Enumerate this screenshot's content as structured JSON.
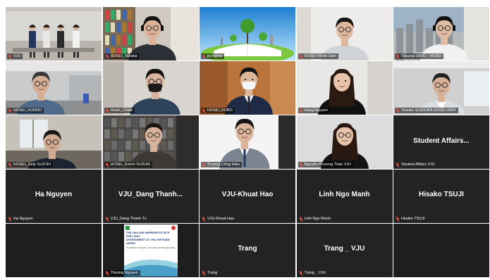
{
  "meeting": {
    "participants": [
      {
        "id": "p1",
        "label": "VJU",
        "scene": "room-group"
      },
      {
        "id": "p2",
        "label": "HOSEI_Tanaka",
        "scene": "man-headset-shelf",
        "active": true
      },
      {
        "id": "p3",
        "label": "pv.Nghia",
        "scene": "landscape-book"
      },
      {
        "id": "p4",
        "label": "HOSEI Hiroki Sato",
        "scene": "man-white-wall"
      },
      {
        "id": "p5",
        "label": "Takuma SATO - HOSEI",
        "scene": "man-window-city"
      },
      {
        "id": "p6",
        "label": "HOSEI_KONDO",
        "scene": "man-office"
      },
      {
        "id": "p7",
        "label": "Hosei_Chida",
        "scene": "man-mask-glasses"
      },
      {
        "id": "p8",
        "label": "HOSEI_KUBO",
        "scene": "man-mask-suit"
      },
      {
        "id": "p9",
        "label": "Hang Nguyen",
        "scene": "woman-long-hair"
      },
      {
        "id": "p10",
        "label": "Yosuke SUGIURA HOSEI UNIV.",
        "scene": "man-glasses-office"
      },
      {
        "id": "p11",
        "label": "HOSEI_Junji SUZUKI",
        "scene": "man-room-window"
      },
      {
        "id": "p12",
        "label": "HOSEI_Koichi SUZUKI",
        "scene": "man-bookshelf"
      },
      {
        "id": "p13",
        "label": "Trương Công Hiếu",
        "scene": "man-suit-white"
      },
      {
        "id": "p14",
        "label": "Nguyễn Phương Thảo VJU",
        "scene": "woman-grey-wall"
      },
      {
        "id": "p15",
        "label": "Student Affairs VJU",
        "display_name": "Student Affairs..."
      },
      {
        "id": "p16",
        "label": "Ha Nguyen",
        "display_name": "Ha Nguyen"
      },
      {
        "id": "p17",
        "label": "VJU_Dang Thanh Tu",
        "display_name": "VJU_Dang Thanh..."
      },
      {
        "id": "p18",
        "label": "VJU-Khuat Hao",
        "display_name": "VJU-Khuat Hao"
      },
      {
        "id": "p19",
        "label": "Linh Ngo Manh",
        "display_name": "Linh Ngo Manh"
      },
      {
        "id": "p20",
        "label": "Hisako TSUJI",
        "display_name": "Hisako TSUJI"
      },
      {
        "id": "p21",
        "label": "",
        "empty": true
      },
      {
        "id": "p22",
        "label": "Thuong Nguyen",
        "scene": "poster"
      },
      {
        "id": "p23",
        "label": "Trang",
        "display_name": "Trang"
      },
      {
        "id": "p24",
        "label": "Trang _ VJU",
        "display_name": "Trang _ VJU"
      },
      {
        "id": "p25",
        "label": "",
        "empty": true
      }
    ],
    "poster": {
      "line1": "THE 23rd ONLINE/REMOTE SITE VISIT AUN",
      "line2": "ASSESSMENT AT VNU VIETNAM JAPAN",
      "line3": "The Master's Program in Environmental Engineering"
    }
  },
  "colors": {
    "tile_bg": "#1e1e1e",
    "active_border": "#d7e34a",
    "mute_icon": "#e5534b",
    "label_text": "#ffffff"
  },
  "icons": {
    "mute": "microphone-muted-icon"
  }
}
